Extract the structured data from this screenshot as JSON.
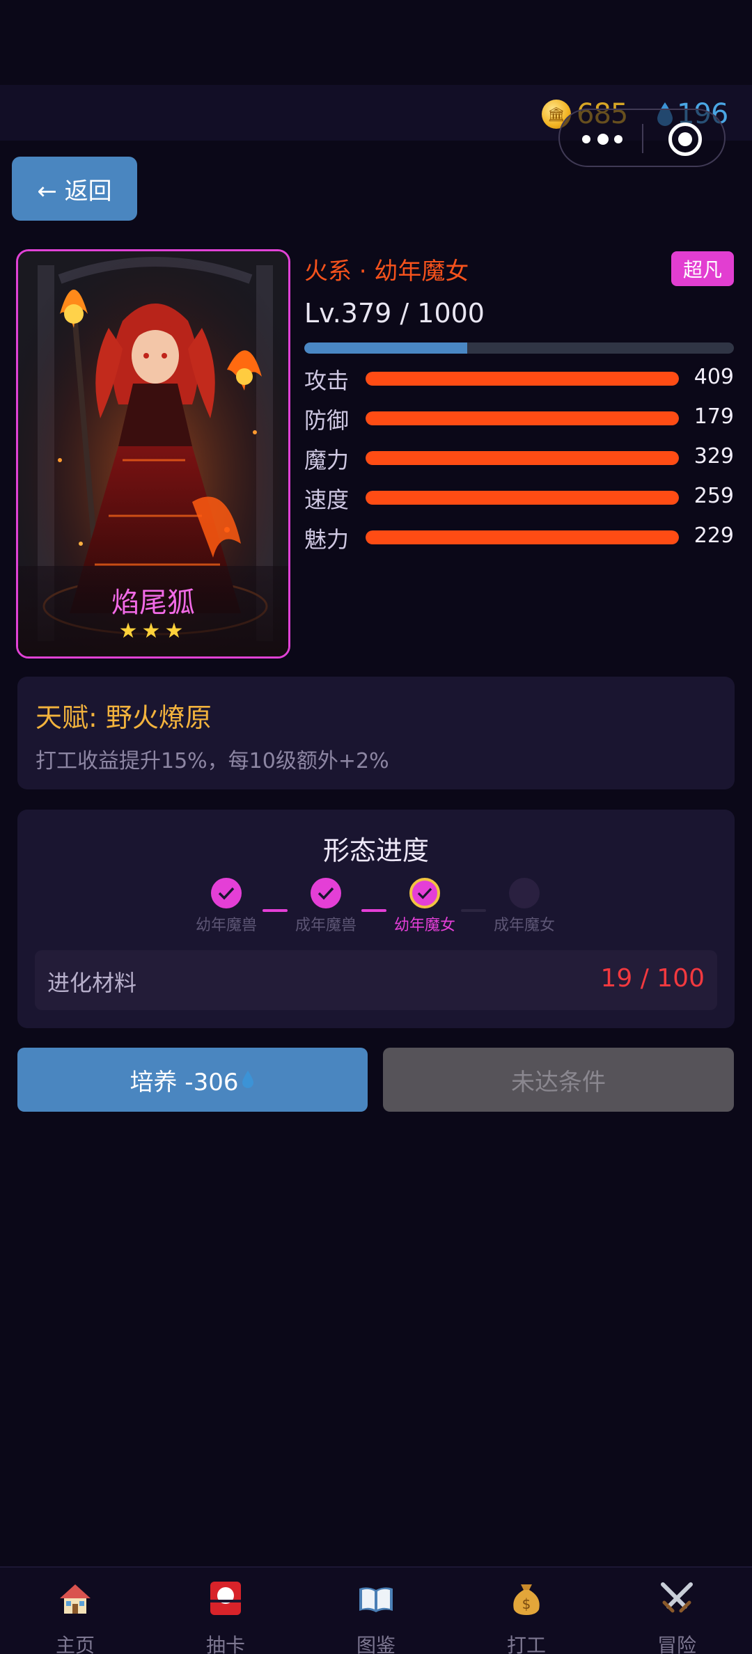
{
  "currency": {
    "coins": "685",
    "gems": "196"
  },
  "back_button": {
    "label": "← 返回"
  },
  "character": {
    "name": "焰尾狐",
    "stars": "★★★",
    "element_stage": "火系 · 幼年魔女",
    "rarity": "超凡",
    "level_text": "Lv.379 / 1000",
    "exp_progress": 0.379,
    "stats": [
      {
        "label": "攻击",
        "value": "409",
        "progress": 1.0
      },
      {
        "label": "防御",
        "value": "179",
        "progress": 1.0
      },
      {
        "label": "魔力",
        "value": "329",
        "progress": 1.0
      },
      {
        "label": "速度",
        "value": "259",
        "progress": 1.0
      },
      {
        "label": "魅力",
        "value": "229",
        "progress": 1.0
      }
    ]
  },
  "talent": {
    "title": "天赋: 野火燎原",
    "description": "打工收益提升15%，每10级额外+2%"
  },
  "evolution": {
    "title": "形态进度",
    "stages": [
      {
        "label": "幼年魔兽",
        "state": "done"
      },
      {
        "label": "成年魔兽",
        "state": "done"
      },
      {
        "label": "幼年魔女",
        "state": "current"
      },
      {
        "label": "成年魔女",
        "state": "locked"
      }
    ],
    "materials_label": "进化材料",
    "materials_value": "19 / 100"
  },
  "actions": {
    "train_label": "培养 -306",
    "evolve_label": "未达条件"
  },
  "nav": [
    {
      "label": "主页",
      "icon": "house-icon"
    },
    {
      "label": "抽卡",
      "icon": "gacha-card-icon"
    },
    {
      "label": "图鉴",
      "icon": "book-icon"
    },
    {
      "label": "打工",
      "icon": "money-bag-icon"
    },
    {
      "label": "冒险",
      "icon": "crossed-swords-icon"
    }
  ],
  "colors": {
    "accent_blue": "#4a86c0",
    "magenta": "#e142d6",
    "stat_orange": "#ff4c14",
    "gold": "#f3b33d",
    "danger_red": "#f2393f"
  }
}
